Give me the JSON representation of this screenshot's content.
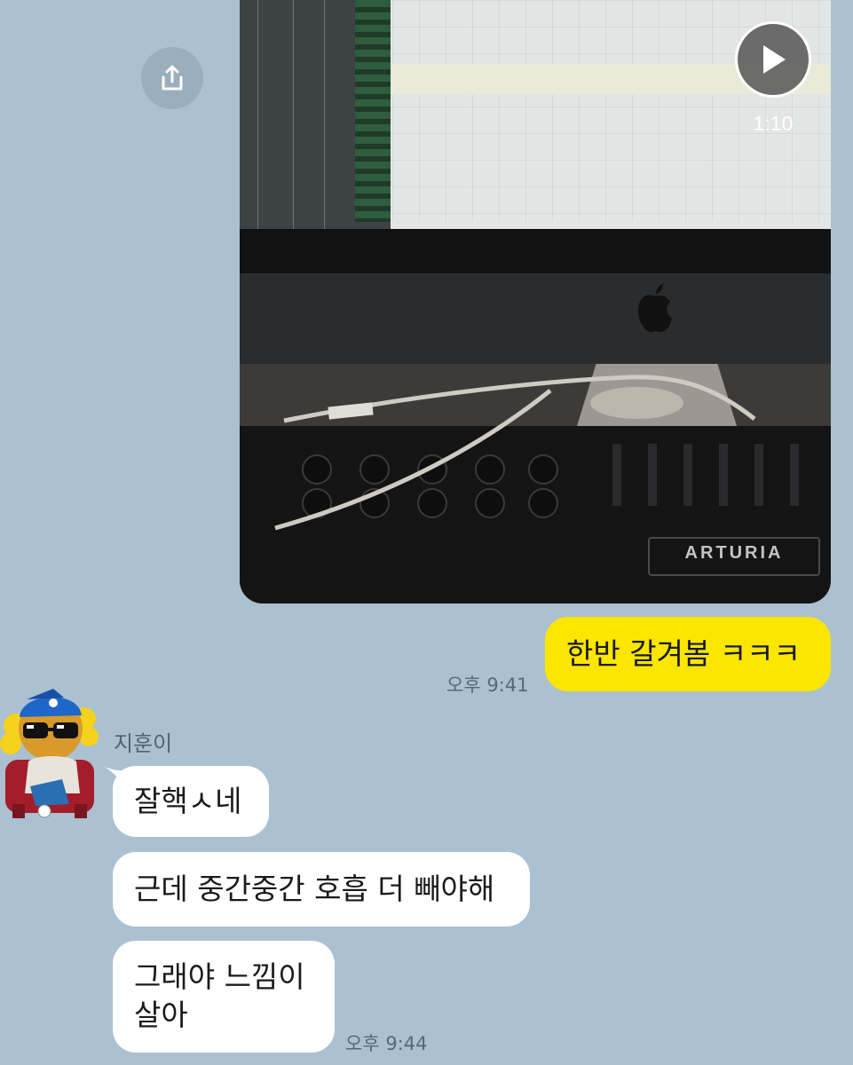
{
  "chat": {
    "video": {
      "duration": "1:10",
      "brand": "ARTURIA",
      "time": ""
    },
    "my_messages": [
      {
        "text": "한반 갈겨봄 ㅋㅋㅋ",
        "time": "오후 9:41"
      }
    ],
    "friend": {
      "name": "지훈이",
      "messages": [
        {
          "text": "잘핵ㅅ네"
        },
        {
          "text": "근데 중간중간 호흡 더 빼야해"
        },
        {
          "text": "그래야 느낌이 살아"
        }
      ],
      "time": "오후 9:44"
    }
  },
  "icons": {
    "share": "share-icon",
    "play": "play-icon",
    "avatar": "ryan-character-avatar"
  },
  "colors": {
    "background": "#abc1d1",
    "my_bubble": "#fbe600",
    "their_bubble": "#ffffff"
  }
}
